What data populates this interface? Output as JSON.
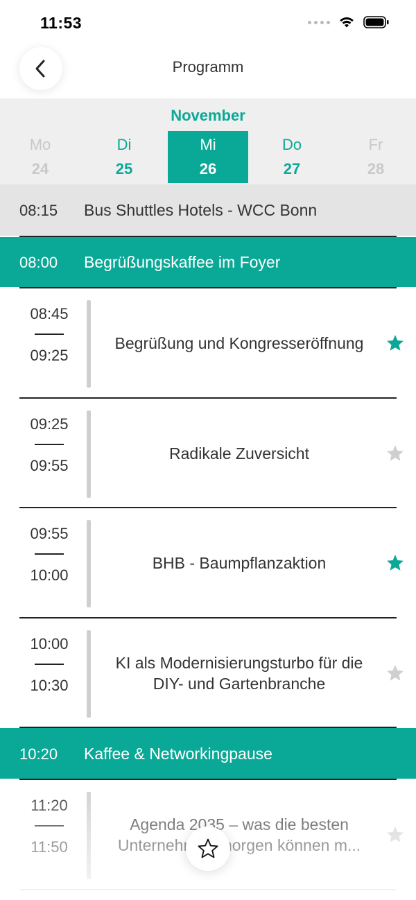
{
  "status_bar": {
    "time": "11:53",
    "icons": [
      "signal-dots-icon",
      "wifi-icon",
      "battery-icon"
    ]
  },
  "nav": {
    "title": "Programm",
    "back_icon": "chevron-left-icon"
  },
  "date_picker": {
    "month": "November",
    "days": [
      {
        "name": "Mo",
        "number": "24",
        "state": "disabled"
      },
      {
        "name": "Di",
        "number": "25",
        "state": "enabled"
      },
      {
        "name": "Mi",
        "number": "26",
        "state": "selected"
      },
      {
        "name": "Do",
        "number": "27",
        "state": "enabled"
      },
      {
        "name": "Fr",
        "number": "28",
        "state": "disabled"
      }
    ]
  },
  "agenda": {
    "highlights": [
      {
        "time": "08:15",
        "title": "Bus Shuttles Hotels - WCC Bonn",
        "style": "gray"
      },
      {
        "time": "08:00",
        "title": "Begrüßungskaffee im Foyer",
        "style": "teal"
      },
      {
        "time": "10:20",
        "title": "Kaffee & Networkingpause",
        "style": "teal"
      }
    ],
    "sessions": [
      {
        "start": "08:45",
        "end": "09:25",
        "title": "Begrüßung und Kongresseröffnung",
        "favorite": true
      },
      {
        "start": "09:25",
        "end": "09:55",
        "title": "Radikale Zuversicht",
        "favorite": false
      },
      {
        "start": "09:55",
        "end": "10:00",
        "title": "BHB - Baumpflanzaktion",
        "favorite": true
      },
      {
        "start": "10:00",
        "end": "10:30",
        "title": "KI als Modernisierungsturbo für die DIY- und Gartenbranche",
        "favorite": false
      },
      {
        "start": "11:20",
        "end": "11:50",
        "title": "Agenda 2035 – was die besten Unternehmen morgen können m...",
        "favorite": false
      }
    ]
  },
  "favorites_button": {
    "icon": "star-outline-icon"
  },
  "colors": {
    "accent": "#0aa896",
    "star_active": "#0aa896",
    "star_inactive": "#cfcfcf",
    "highlight_gray": "#e4e4e4",
    "date_strip_bg": "#efefef"
  }
}
